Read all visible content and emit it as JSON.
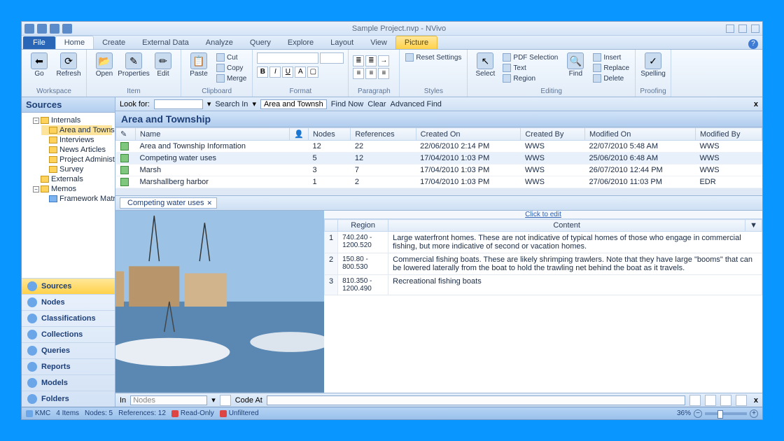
{
  "window": {
    "title": "Sample Project.nvp - NVivo"
  },
  "tabs": {
    "file": "File",
    "items": [
      "Home",
      "Create",
      "External Data",
      "Analyze",
      "Query",
      "Explore",
      "Layout",
      "View"
    ],
    "context_header": "Picture",
    "context": "Picture",
    "active": "Home"
  },
  "ribbon": {
    "workspace": {
      "label": "Workspace",
      "go": "Go",
      "refresh": "Refresh"
    },
    "item": {
      "label": "Item",
      "open": "Open",
      "properties": "Properties",
      "edit": "Edit"
    },
    "clipboard": {
      "label": "Clipboard",
      "paste": "Paste",
      "cut": "Cut",
      "copy": "Copy",
      "merge": "Merge"
    },
    "format": {
      "label": "Format"
    },
    "paragraph": {
      "label": "Paragraph"
    },
    "styles": {
      "label": "Styles",
      "reset": "Reset Settings"
    },
    "editing": {
      "label": "Editing",
      "select": "Select",
      "find": "Find",
      "pdfsel": "PDF Selection",
      "text": "Text",
      "region": "Region",
      "insert": "Insert",
      "replace": "Replace",
      "delete": "Delete"
    },
    "proofing": {
      "label": "Proofing",
      "spelling": "Spelling"
    }
  },
  "sources": {
    "title": "Sources",
    "tree": [
      {
        "label": "Internals",
        "expanded": true,
        "children": [
          {
            "label": "Area and Township",
            "sel": true
          },
          {
            "label": "Interviews"
          },
          {
            "label": "News Articles"
          },
          {
            "label": "Project Administration"
          },
          {
            "label": "Survey"
          }
        ]
      },
      {
        "label": "Externals"
      },
      {
        "label": "Memos",
        "expanded": true,
        "children": [
          {
            "label": "Framework Matrices",
            "blue": true
          }
        ]
      }
    ]
  },
  "nav": [
    "Sources",
    "Nodes",
    "Classifications",
    "Collections",
    "Queries",
    "Reports",
    "Models",
    "Folders"
  ],
  "nav_active": "Sources",
  "search": {
    "lookfor": "Look for:",
    "searchin": "Search In",
    "scope": "Area and Townsh",
    "findnow": "Find Now",
    "clear": "Clear",
    "advanced": "Advanced Find"
  },
  "detail": {
    "title": "Area and Township",
    "columns": [
      "Name",
      "Nodes",
      "References",
      "Created On",
      "Created By",
      "Modified On",
      "Modified By"
    ],
    "rows": [
      {
        "name": "Area and Township Information",
        "nodes": "12",
        "refs": "22",
        "created": "22/06/2010 2:14 PM",
        "cby": "WWS",
        "modified": "22/07/2010 5:48 AM",
        "mby": "WWS"
      },
      {
        "name": "Competing water uses",
        "nodes": "5",
        "refs": "12",
        "created": "17/04/2010 1:03 PM",
        "cby": "WWS",
        "modified": "25/06/2010 6:48 AM",
        "mby": "WWS",
        "sel": true
      },
      {
        "name": "Marsh",
        "nodes": "3",
        "refs": "7",
        "created": "17/04/2010 1:03 PM",
        "cby": "WWS",
        "modified": "26/07/2010 12:44 PM",
        "mby": "WWS"
      },
      {
        "name": "Marshallberg harbor",
        "nodes": "1",
        "refs": "2",
        "created": "17/04/2010 1:03 PM",
        "cby": "WWS",
        "modified": "27/06/2010 11:03 PM",
        "mby": "EDR"
      }
    ],
    "open_tab": "Competing water uses",
    "click_to_edit": "Click to edit",
    "region_cols": [
      "",
      "Region",
      "Content"
    ],
    "regions": [
      {
        "n": "1",
        "region": "740.240 - 1200.520",
        "content": "Large waterfront homes. These are not indicative of typical homes of those who engage in commercial fishing, but more indicative of second or vacation homes."
      },
      {
        "n": "2",
        "region": "150.80 - 800.530",
        "content": "Commercial fishing boats. These are likely shrimping trawlers. Note that they have large \"booms\" that can be lowered laterally from the boat to hold the trawling net behind the boat as it travels."
      },
      {
        "n": "3",
        "region": "810.350 - 1200.490",
        "content": "Recreational fishing boats"
      }
    ]
  },
  "codebar": {
    "in": "In",
    "nodes": "Nodes",
    "codeat": "Code At"
  },
  "status": {
    "user": "KMC",
    "items": "4 Items",
    "nodes": "Nodes: 5",
    "refs": "References: 12",
    "readonly": "Read-Only",
    "unfiltered": "Unfiltered",
    "zoom": "36%"
  }
}
